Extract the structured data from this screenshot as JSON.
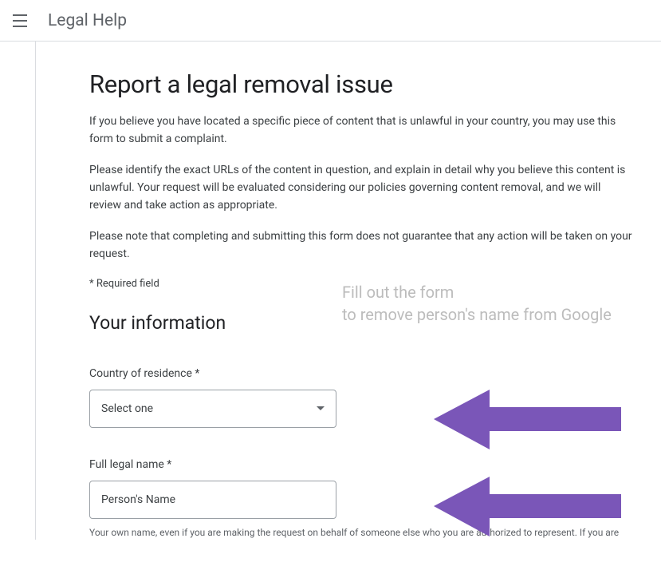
{
  "header": {
    "title": "Legal Help"
  },
  "main": {
    "title": "Report a legal removal issue",
    "para1": "If you believe you have located a specific piece of content that is unlawful in your country, you may use this form to submit a complaint.",
    "para2": "Please identify the exact URLs of the content in question, and explain in detail why you believe this content is unlawful. Your request will be evaluated considering our policies governing content removal, and we will review and take action as appropriate.",
    "para3": "Please note that completing and submitting this form does not guarantee that any action will be taken on your request.",
    "required_label": "* Required field",
    "section_heading": "Your information",
    "country": {
      "label": "Country of residence *",
      "selected": "Select one"
    },
    "name": {
      "label": "Full legal name *",
      "value": "Person's Name",
      "help": "Your own name, even if you are making the request on behalf of someone else who you are authorized to represent. If you are"
    }
  },
  "overlay": {
    "line1": "Fill out the form",
    "line2": "to  remove person's name from Google"
  }
}
